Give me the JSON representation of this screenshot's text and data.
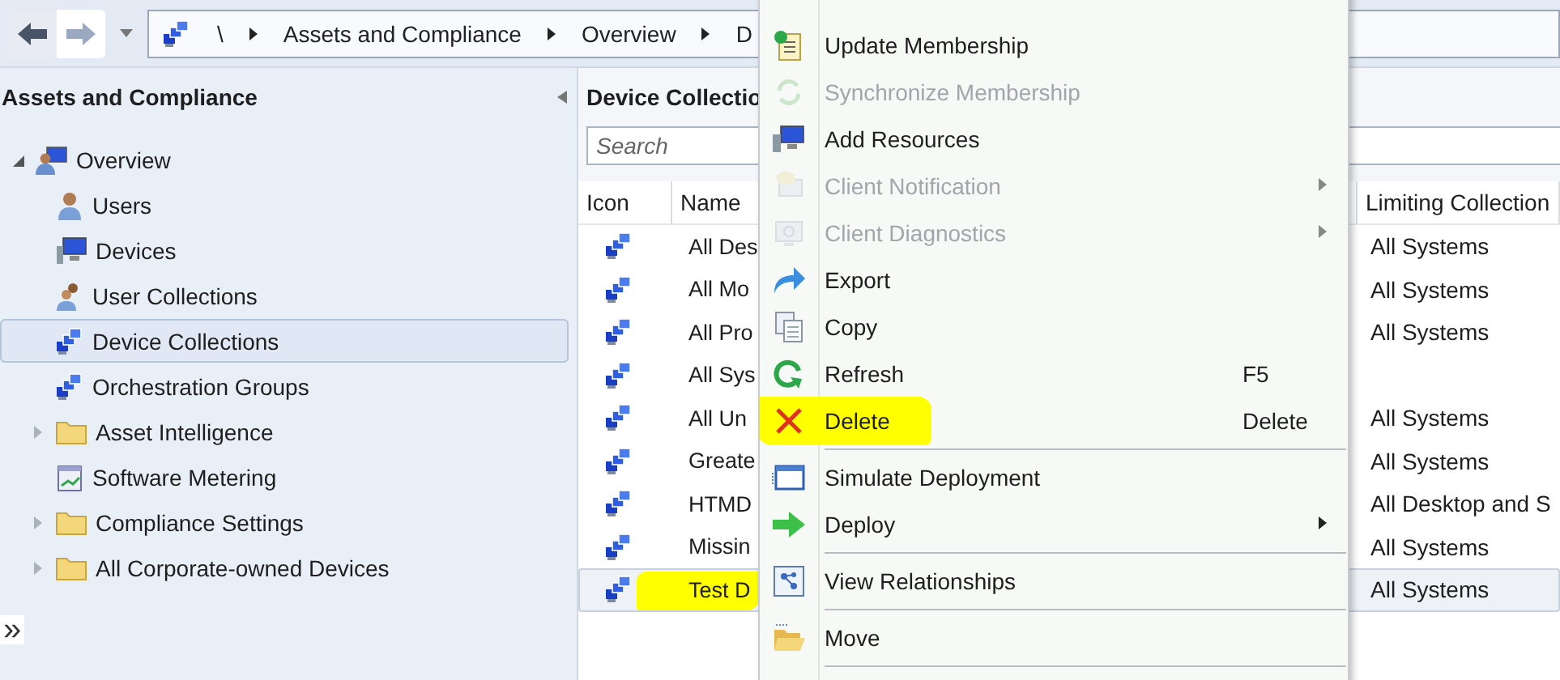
{
  "toolbar": {
    "breadcrumb": [
      "\\",
      "Assets and Compliance",
      "Overview",
      "D"
    ]
  },
  "navigation": {
    "title": "Assets and Compliance",
    "expand_button": "»",
    "tree": [
      {
        "label": "Overview",
        "kind": "overview",
        "expanded": true,
        "selected": false,
        "children": [
          {
            "label": "Users",
            "kind": "users",
            "selected": false
          },
          {
            "label": "Devices",
            "kind": "devices",
            "selected": false
          },
          {
            "label": "User Collections",
            "kind": "user-collection",
            "selected": false
          },
          {
            "label": "Device Collections",
            "kind": "device-collection",
            "selected": true
          },
          {
            "label": "Orchestration Groups",
            "kind": "device-collection",
            "selected": false
          },
          {
            "label": "Asset Intelligence",
            "kind": "folder",
            "expanded": false,
            "selected": false
          },
          {
            "label": "Software Metering",
            "kind": "metering",
            "selected": false
          },
          {
            "label": "Compliance Settings",
            "kind": "folder",
            "expanded": false,
            "selected": false
          },
          {
            "label": "All Corporate-owned Devices",
            "kind": "folder",
            "expanded": false,
            "selected": false
          }
        ]
      }
    ]
  },
  "content": {
    "title": "Device Collectio",
    "search": {
      "placeholder": "Search"
    },
    "table": {
      "columns": [
        "Icon",
        "Name",
        "Limiting Collection"
      ],
      "rows": [
        {
          "name": "All Des",
          "limiting_collection": "All Systems",
          "selected": false,
          "highlighted": false
        },
        {
          "name": "All Mo",
          "limiting_collection": "All Systems",
          "selected": false,
          "highlighted": false
        },
        {
          "name": "All Pro",
          "limiting_collection": "All Systems",
          "selected": false,
          "highlighted": false
        },
        {
          "name": "All Sys",
          "limiting_collection": "",
          "selected": false,
          "highlighted": false
        },
        {
          "name": "All Un",
          "limiting_collection": "All Systems",
          "selected": false,
          "highlighted": false
        },
        {
          "name": "Greate",
          "limiting_collection": "All Systems",
          "selected": false,
          "highlighted": false
        },
        {
          "name": "HTMD",
          "limiting_collection": "All Desktop and S",
          "selected": false,
          "highlighted": false
        },
        {
          "name": "Missin",
          "limiting_collection": "All Systems",
          "selected": false,
          "highlighted": false
        },
        {
          "name": "Test D",
          "limiting_collection": "All Systems",
          "selected": true,
          "highlighted": true
        }
      ]
    }
  },
  "context_menu": {
    "items": [
      {
        "kind": "item",
        "label": "Update Membership",
        "disabled": false,
        "submenu": false,
        "highlighted": false
      },
      {
        "kind": "item",
        "label": "Synchronize Membership",
        "disabled": true,
        "submenu": false,
        "highlighted": false
      },
      {
        "kind": "item",
        "label": "Add Resources",
        "disabled": false,
        "submenu": false,
        "highlighted": false
      },
      {
        "kind": "item",
        "label": "Client Notification",
        "disabled": true,
        "submenu": true,
        "highlighted": false
      },
      {
        "kind": "item",
        "label": "Client Diagnostics",
        "disabled": true,
        "submenu": true,
        "highlighted": false
      },
      {
        "kind": "item",
        "label": "Export",
        "disabled": false,
        "submenu": false,
        "highlighted": false
      },
      {
        "kind": "item",
        "label": "Copy",
        "disabled": false,
        "submenu": false,
        "highlighted": false
      },
      {
        "kind": "item",
        "label": "Refresh",
        "shortcut": "F5",
        "disabled": false,
        "submenu": false,
        "highlighted": false
      },
      {
        "kind": "item",
        "label": "Delete",
        "shortcut": "Delete",
        "disabled": false,
        "submenu": false,
        "highlighted": true
      },
      {
        "kind": "separator"
      },
      {
        "kind": "item",
        "label": "Simulate Deployment",
        "disabled": false,
        "submenu": false,
        "highlighted": false
      },
      {
        "kind": "item",
        "label": "Deploy",
        "disabled": false,
        "submenu": true,
        "highlighted": false
      },
      {
        "kind": "separator"
      },
      {
        "kind": "item",
        "label": "View Relationships",
        "disabled": false,
        "submenu": false,
        "highlighted": false
      },
      {
        "kind": "separator"
      },
      {
        "kind": "item",
        "label": "Move",
        "disabled": false,
        "submenu": false,
        "highlighted": false
      },
      {
        "kind": "separator"
      }
    ]
  }
}
